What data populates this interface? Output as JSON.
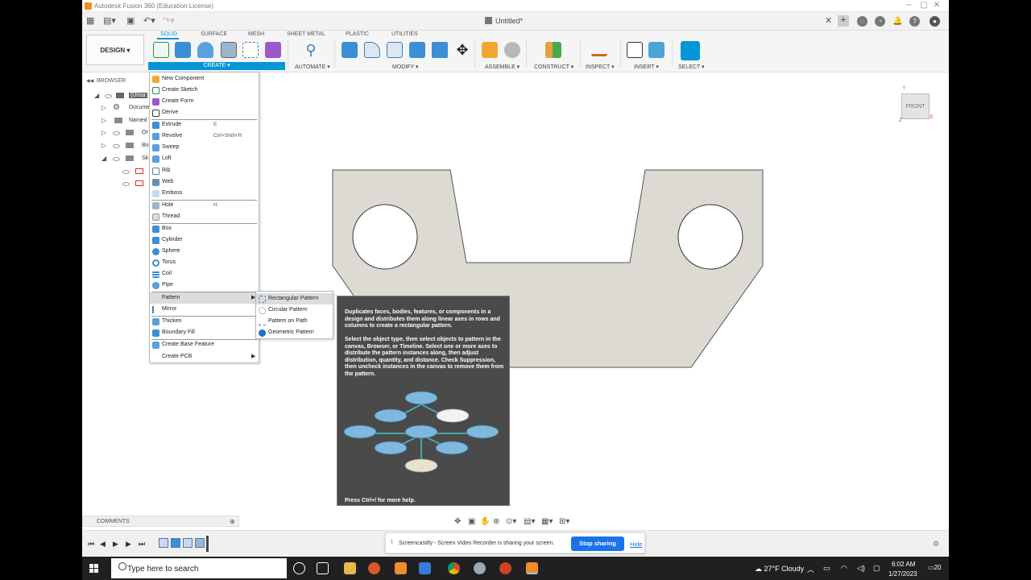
{
  "window": {
    "title": "Autodesk Fusion 360 (Education License)",
    "document_tab": "Untitled*",
    "close_glyph": "✕",
    "maximize_glyph": "▢",
    "minimize_glyph": "─",
    "new_tab_glyph": "+"
  },
  "toolbar": {
    "workspace_button": "DESIGN ▾",
    "tabs": [
      "SOLID",
      "SURFACE",
      "MESH",
      "SHEET METAL",
      "PLASTIC",
      "UTILITIES"
    ],
    "groups": [
      "CREATE ▾",
      "AUTOMATE ▾",
      "MODIFY ▾",
      "ASSEMBLE ▾",
      "CONSTRUCT ▾",
      "INSPECT ▾",
      "INSERT ▾",
      "SELECT ▾"
    ]
  },
  "browser": {
    "title": "BROWSER",
    "rows": [
      "(Unsa",
      "Docume",
      "Named V",
      "Or",
      "Bo",
      "Sk"
    ]
  },
  "create_menu": {
    "items": [
      {
        "label": "New Component",
        "shortcut": ""
      },
      {
        "label": "Create Sketch",
        "shortcut": ""
      },
      {
        "label": "Create Form",
        "shortcut": ""
      },
      {
        "label": "Derive",
        "shortcut": ""
      },
      {
        "label": "Extrude",
        "shortcut": "E"
      },
      {
        "label": "Revolve",
        "shortcut": "Ctrl+Shift+R"
      },
      {
        "label": "Sweep",
        "shortcut": ""
      },
      {
        "label": "Loft",
        "shortcut": ""
      },
      {
        "label": "Rib",
        "shortcut": ""
      },
      {
        "label": "Web",
        "shortcut": ""
      },
      {
        "label": "Emboss",
        "shortcut": ""
      },
      {
        "label": "Hole",
        "shortcut": "H"
      },
      {
        "label": "Thread",
        "shortcut": ""
      },
      {
        "label": "Box",
        "shortcut": ""
      },
      {
        "label": "Cylinder",
        "shortcut": ""
      },
      {
        "label": "Sphere",
        "shortcut": ""
      },
      {
        "label": "Torus",
        "shortcut": ""
      },
      {
        "label": "Coil",
        "shortcut": ""
      },
      {
        "label": "Pipe",
        "shortcut": ""
      },
      {
        "label": "Pattern",
        "shortcut": ""
      },
      {
        "label": "Mirror",
        "shortcut": ""
      },
      {
        "label": "Thicken",
        "shortcut": ""
      },
      {
        "label": "Boundary Fill",
        "shortcut": ""
      },
      {
        "label": "Create Base Feature",
        "shortcut": ""
      },
      {
        "label": "Create PCB",
        "shortcut": ""
      }
    ],
    "submenu_arrow": "▶"
  },
  "pattern_menu": {
    "items": [
      "Rectangular Pattern",
      "Circular Pattern",
      "Pattern on Path",
      "Geometric Pattern"
    ]
  },
  "tooltip": {
    "p1": "Duplicates faces, bodies, features, or components in a design and distributes them along linear axes in rows and columns to create a rectangular pattern.",
    "p2": "Select the object type, then select objects to pattern in the canvas, Browser, or Timeline. Select one or more axes to distribute the pattern instances along, then adjust distribution, quantity, and distance. Check Suppression, then uncheck instances in the canvas to remove them from the pattern.",
    "footer": "Press Ctrl+/ for more help."
  },
  "viewcube": {
    "face": "FRONT",
    "x": "X",
    "y": "Y",
    "z": "Z"
  },
  "comments": {
    "label": "COMMENTS"
  },
  "screencastify": {
    "message": "Screencastify - Screen Video Recorder is sharing your screen.",
    "stop_label": "Stop sharing",
    "hide_label": "Hide"
  },
  "taskbar": {
    "search_placeholder": "Type here to search",
    "weather": "27°F  Cloudy",
    "time": "6:02 AM",
    "date": "1/27/2023",
    "notification_count": "20"
  },
  "colors": {
    "accent": "#0696d7",
    "part_fill": "#dcdad2",
    "tooltip_bg": "#4a4a4a",
    "stop_button": "#1a73e8"
  }
}
